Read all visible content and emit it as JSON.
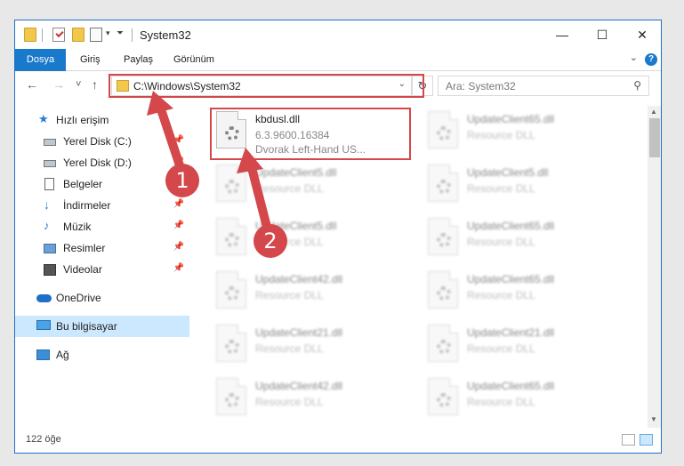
{
  "window": {
    "title": "System32",
    "minimize": "—",
    "maximize": "☐",
    "close": "✕"
  },
  "ribbon": {
    "tabs": [
      "Dosya",
      "Giriş",
      "Paylaş",
      "Görünüm"
    ],
    "collapse_icon": "chevron-down",
    "help": "?"
  },
  "navigation": {
    "back": "←",
    "forward": "→",
    "recent": "˅",
    "up": "↑",
    "address": "C:\\Windows\\System32",
    "refresh": "↻",
    "search_placeholder": "Ara: System32"
  },
  "sidebar": {
    "items": [
      {
        "label": "Hızlı erişim",
        "icon": "star-icon"
      },
      {
        "label": "Yerel Disk (C:)",
        "icon": "drive-icon",
        "pinned": true
      },
      {
        "label": "Yerel Disk (D:)",
        "icon": "drive-icon",
        "pinned": true
      },
      {
        "label": "Belgeler",
        "icon": "document-icon",
        "pinned": true
      },
      {
        "label": "İndirmeler",
        "icon": "download-icon",
        "pinned": true
      },
      {
        "label": "Müzik",
        "icon": "music-icon",
        "pinned": true
      },
      {
        "label": "Resimler",
        "icon": "pictures-icon",
        "pinned": true
      },
      {
        "label": "Videolar",
        "icon": "videos-icon",
        "pinned": true
      },
      {
        "label": "OneDrive",
        "icon": "cloud-icon"
      },
      {
        "label": "Bu bilgisayar",
        "icon": "computer-icon",
        "selected": true
      },
      {
        "label": "Ağ",
        "icon": "network-icon"
      }
    ]
  },
  "files": [
    {
      "name": "kbdusl.dll",
      "line2": "6.3.9600.16384",
      "line3": "Dvorak Left-Hand US...",
      "highlighted": true
    },
    {
      "name": "UpdateClient65.dll",
      "line2": "Resource DLL"
    },
    {
      "name": "UpdateClient5.dll",
      "line2": "Resource DLL"
    },
    {
      "name": "UpdateClient5.dll",
      "line2": "Resource DLL"
    },
    {
      "name": "UpdateClient5.dll",
      "line2": "Resource DLL"
    },
    {
      "name": "UpdateClient65.dll",
      "line2": "Resource DLL"
    },
    {
      "name": "UpdateClient42.dll",
      "line2": "Resource DLL"
    },
    {
      "name": "UpdateClient65.dll",
      "line2": "Resource DLL"
    },
    {
      "name": "UpdateClient21.dll",
      "line2": "Resource DLL"
    },
    {
      "name": "UpdateClient21.dll",
      "line2": "Resource DLL"
    },
    {
      "name": "UpdateClient42.dll",
      "line2": "Resource DLL"
    },
    {
      "name": "UpdateClient65.dll",
      "line2": "Resource DLL"
    }
  ],
  "status": {
    "item_count": "122 öğe"
  },
  "annotations": {
    "badge1": "1",
    "badge2": "2",
    "color": "#d4474b"
  }
}
